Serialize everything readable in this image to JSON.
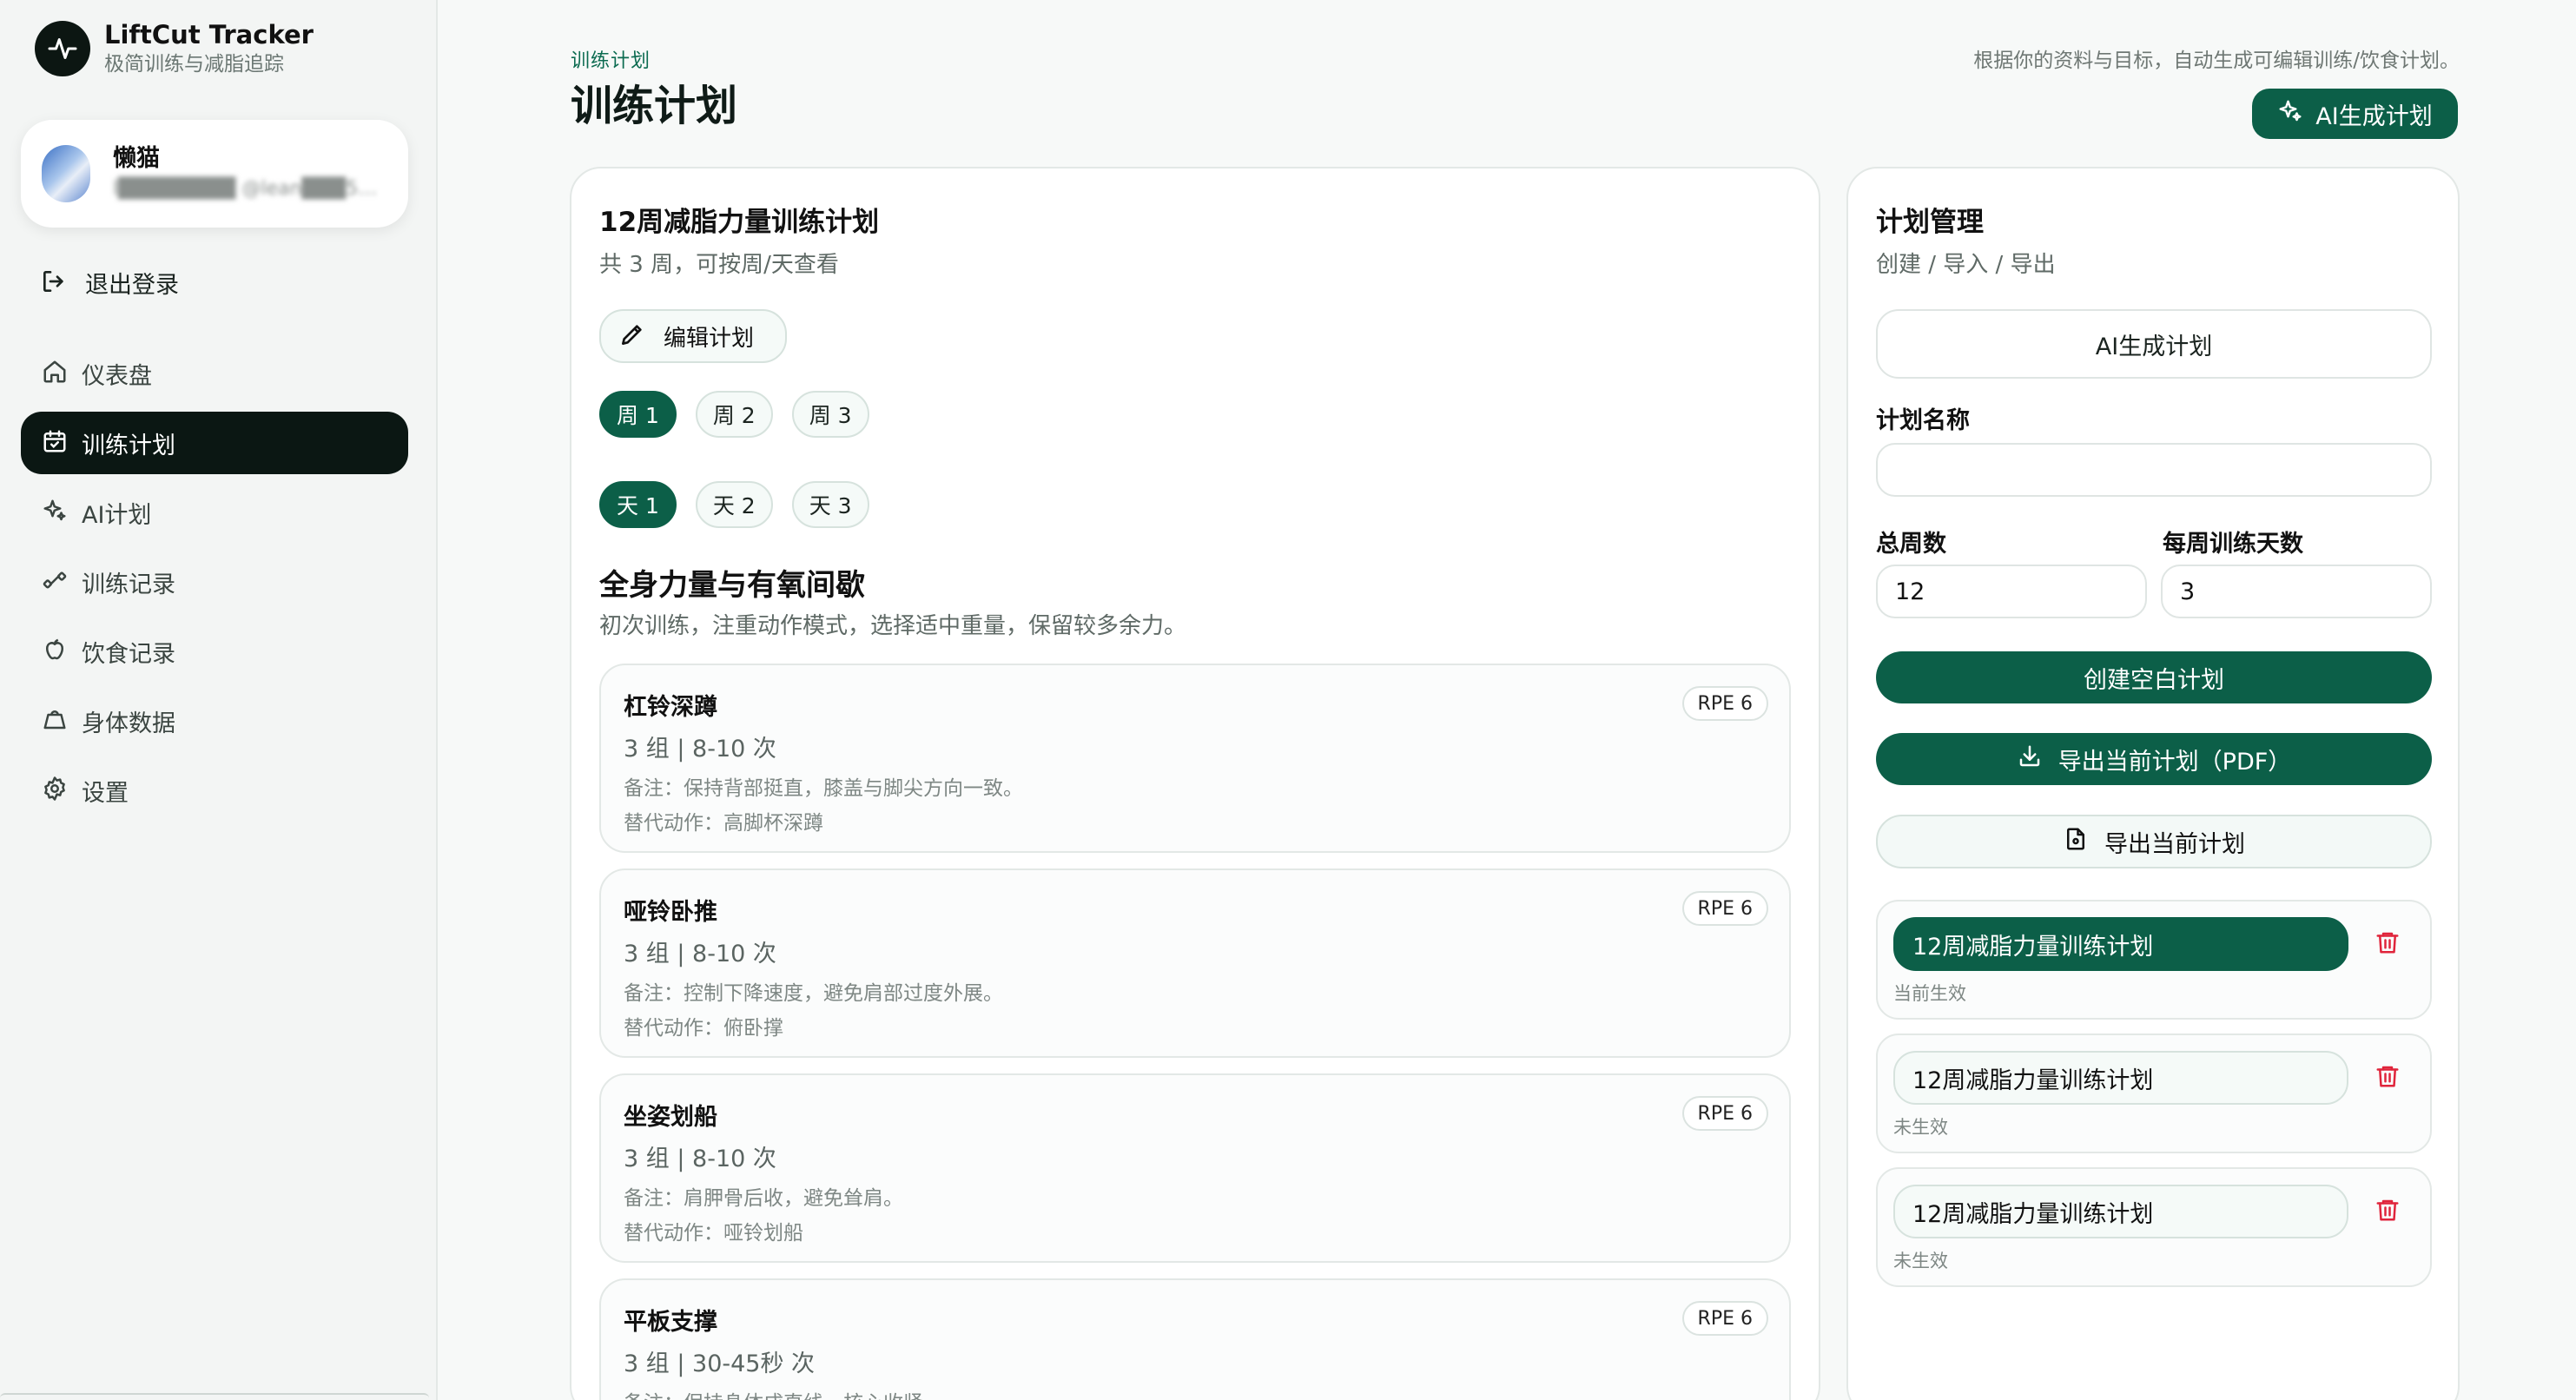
{
  "app": {
    "title": "LiftCut Tracker",
    "subtitle": "极简训练与减脂追踪"
  },
  "user": {
    "name": "懒猫",
    "email": "l████████ @lean███58..."
  },
  "sidebar": {
    "logout_label": "退出登录",
    "items": [
      {
        "label": "仪表盘",
        "icon": "home-icon",
        "active": false
      },
      {
        "label": "训练计划",
        "icon": "calendar-icon",
        "active": true
      },
      {
        "label": "AI计划",
        "icon": "sparkles-icon",
        "active": false
      },
      {
        "label": "训练记录",
        "icon": "dumbbell-icon",
        "active": false
      },
      {
        "label": "饮食记录",
        "icon": "apple-icon",
        "active": false
      },
      {
        "label": "身体数据",
        "icon": "weight-icon",
        "active": false
      },
      {
        "label": "设置",
        "icon": "gear-icon",
        "active": false
      }
    ]
  },
  "header": {
    "eyebrow": "训练计划",
    "title": "训练计划",
    "description": "根据你的资料与目标，自动生成可编辑训练/饮食计划。",
    "ai_button": "AI生成计划"
  },
  "plan": {
    "title": "12周减脂力量训练计划",
    "subtitle": "共 3 周，可按周/天查看",
    "edit_button": "编辑计划",
    "weeks": [
      "周 1",
      "周 2",
      "周 3"
    ],
    "active_week": 0,
    "days": [
      "天 1",
      "天 2",
      "天 3"
    ],
    "active_day": 0,
    "day_title": "全身力量与有氧间歇",
    "day_description": "初次训练，注重动作模式，选择适中重量，保留较多余力。",
    "exercises": [
      {
        "name": "杠铃深蹲",
        "rpe": "RPE 6",
        "sets": "3 组 | 8-10 次",
        "note": "备注：保持背部挺直，膝盖与脚尖方向一致。",
        "alt": "替代动作：高脚杯深蹲"
      },
      {
        "name": "哑铃卧推",
        "rpe": "RPE 6",
        "sets": "3 组 | 8-10 次",
        "note": "备注：控制下降速度，避免肩部过度外展。",
        "alt": "替代动作：俯卧撑"
      },
      {
        "name": "坐姿划船",
        "rpe": "RPE 6",
        "sets": "3 组 | 8-10 次",
        "note": "备注：肩胛骨后收，避免耸肩。",
        "alt": "替代动作：哑铃划船"
      },
      {
        "name": "平板支撑",
        "rpe": "RPE 6",
        "sets": "3 组 | 30-45秒 次",
        "note": "备注：保持身体成直线，核心收紧",
        "alt": ""
      }
    ]
  },
  "manage": {
    "title": "计划管理",
    "subtitle": "创建 / 导入 / 导出",
    "ai_button": "AI生成计划",
    "name_label": "计划名称",
    "name_value": "",
    "weeks_label": "总周数",
    "weeks_value": "12",
    "days_label": "每周训练天数",
    "days_value": "3",
    "create_button": "创建空白计划",
    "export_pdf_button": "导出当前计划（PDF）",
    "export_button": "导出当前计划",
    "plans": [
      {
        "name": "12周减脂力量训练计划",
        "status": "当前生效",
        "active": true
      },
      {
        "name": "12周减脂力量训练计划",
        "status": "未生效",
        "active": false
      },
      {
        "name": "12周减脂力量训练计划",
        "status": "未生效",
        "active": false
      }
    ]
  },
  "colors": {
    "accent": "#0c5f48",
    "sidebar_active": "#0b1713",
    "danger": "#e0243b"
  }
}
